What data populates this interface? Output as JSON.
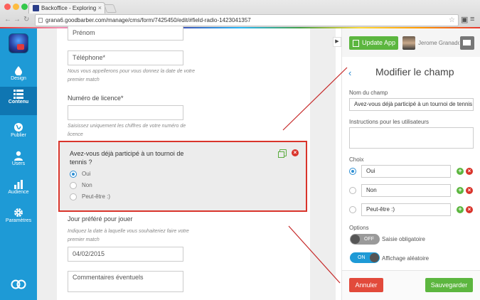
{
  "browser": {
    "tab_title": "Backoffice - Exploring",
    "url": "grana6.goodbarber.com/manage/cms/form/7425450/edit/#field-radio-1423041357"
  },
  "sidebar": {
    "items": [
      {
        "label": "Design",
        "icon": "drop-icon"
      },
      {
        "label": "Contenu",
        "icon": "list-icon",
        "active": true
      },
      {
        "label": "Publier",
        "icon": "globe-icon"
      },
      {
        "label": "Users",
        "icon": "user-icon"
      },
      {
        "label": "Audience",
        "icon": "bar-chart-icon"
      },
      {
        "label": "Paramètres",
        "icon": "gear-icon"
      }
    ]
  },
  "form": {
    "prenom_placeholder": "Prénom",
    "telephone_placeholder": "Téléphone*",
    "telephone_help": "Nous vous appellerons pour vous donnez la date de votre premier match",
    "licence_label": "Numéro de licence*",
    "licence_help": "Saisissez uniquement les chiffres de votre numéro de licence",
    "radio_question": "Avez-vous déjà participé à un tournoi de tennis ?",
    "radio_options": [
      "Oui",
      "Non",
      "Peut-être :)"
    ],
    "jour_label": "Jour préféré pour jouer",
    "jour_help": "Indiquez la date à laquelle vous souhaiteriez faire votre premier match",
    "jour_value": "04/02/2015",
    "comments_placeholder": "Commentaires éventuels"
  },
  "panel": {
    "update_button": "Update App",
    "user_name": "Jerome Granados",
    "back": "‹",
    "title": "Modifier le champ",
    "name_label": "Nom du champ",
    "name_value": "Avez-vous déjà participé à un tournoi de tennis ?",
    "instructions_label": "Instructions pour les utilisateurs",
    "choices_label": "Choix",
    "choices": [
      "Oui",
      "Non",
      "Peut-être :)"
    ],
    "options_label": "Options",
    "toggle_required": {
      "state": "OFF",
      "label": "Saisie obligatoire"
    },
    "toggle_random": {
      "state": "ON",
      "label": "Affichage aléatoire"
    },
    "cancel": "Annuler",
    "save": "Sauvegarder"
  },
  "colors": {
    "sidebar": "#1e9ad6",
    "accent_red": "#d9342b",
    "accent_green": "#5cb63f"
  }
}
